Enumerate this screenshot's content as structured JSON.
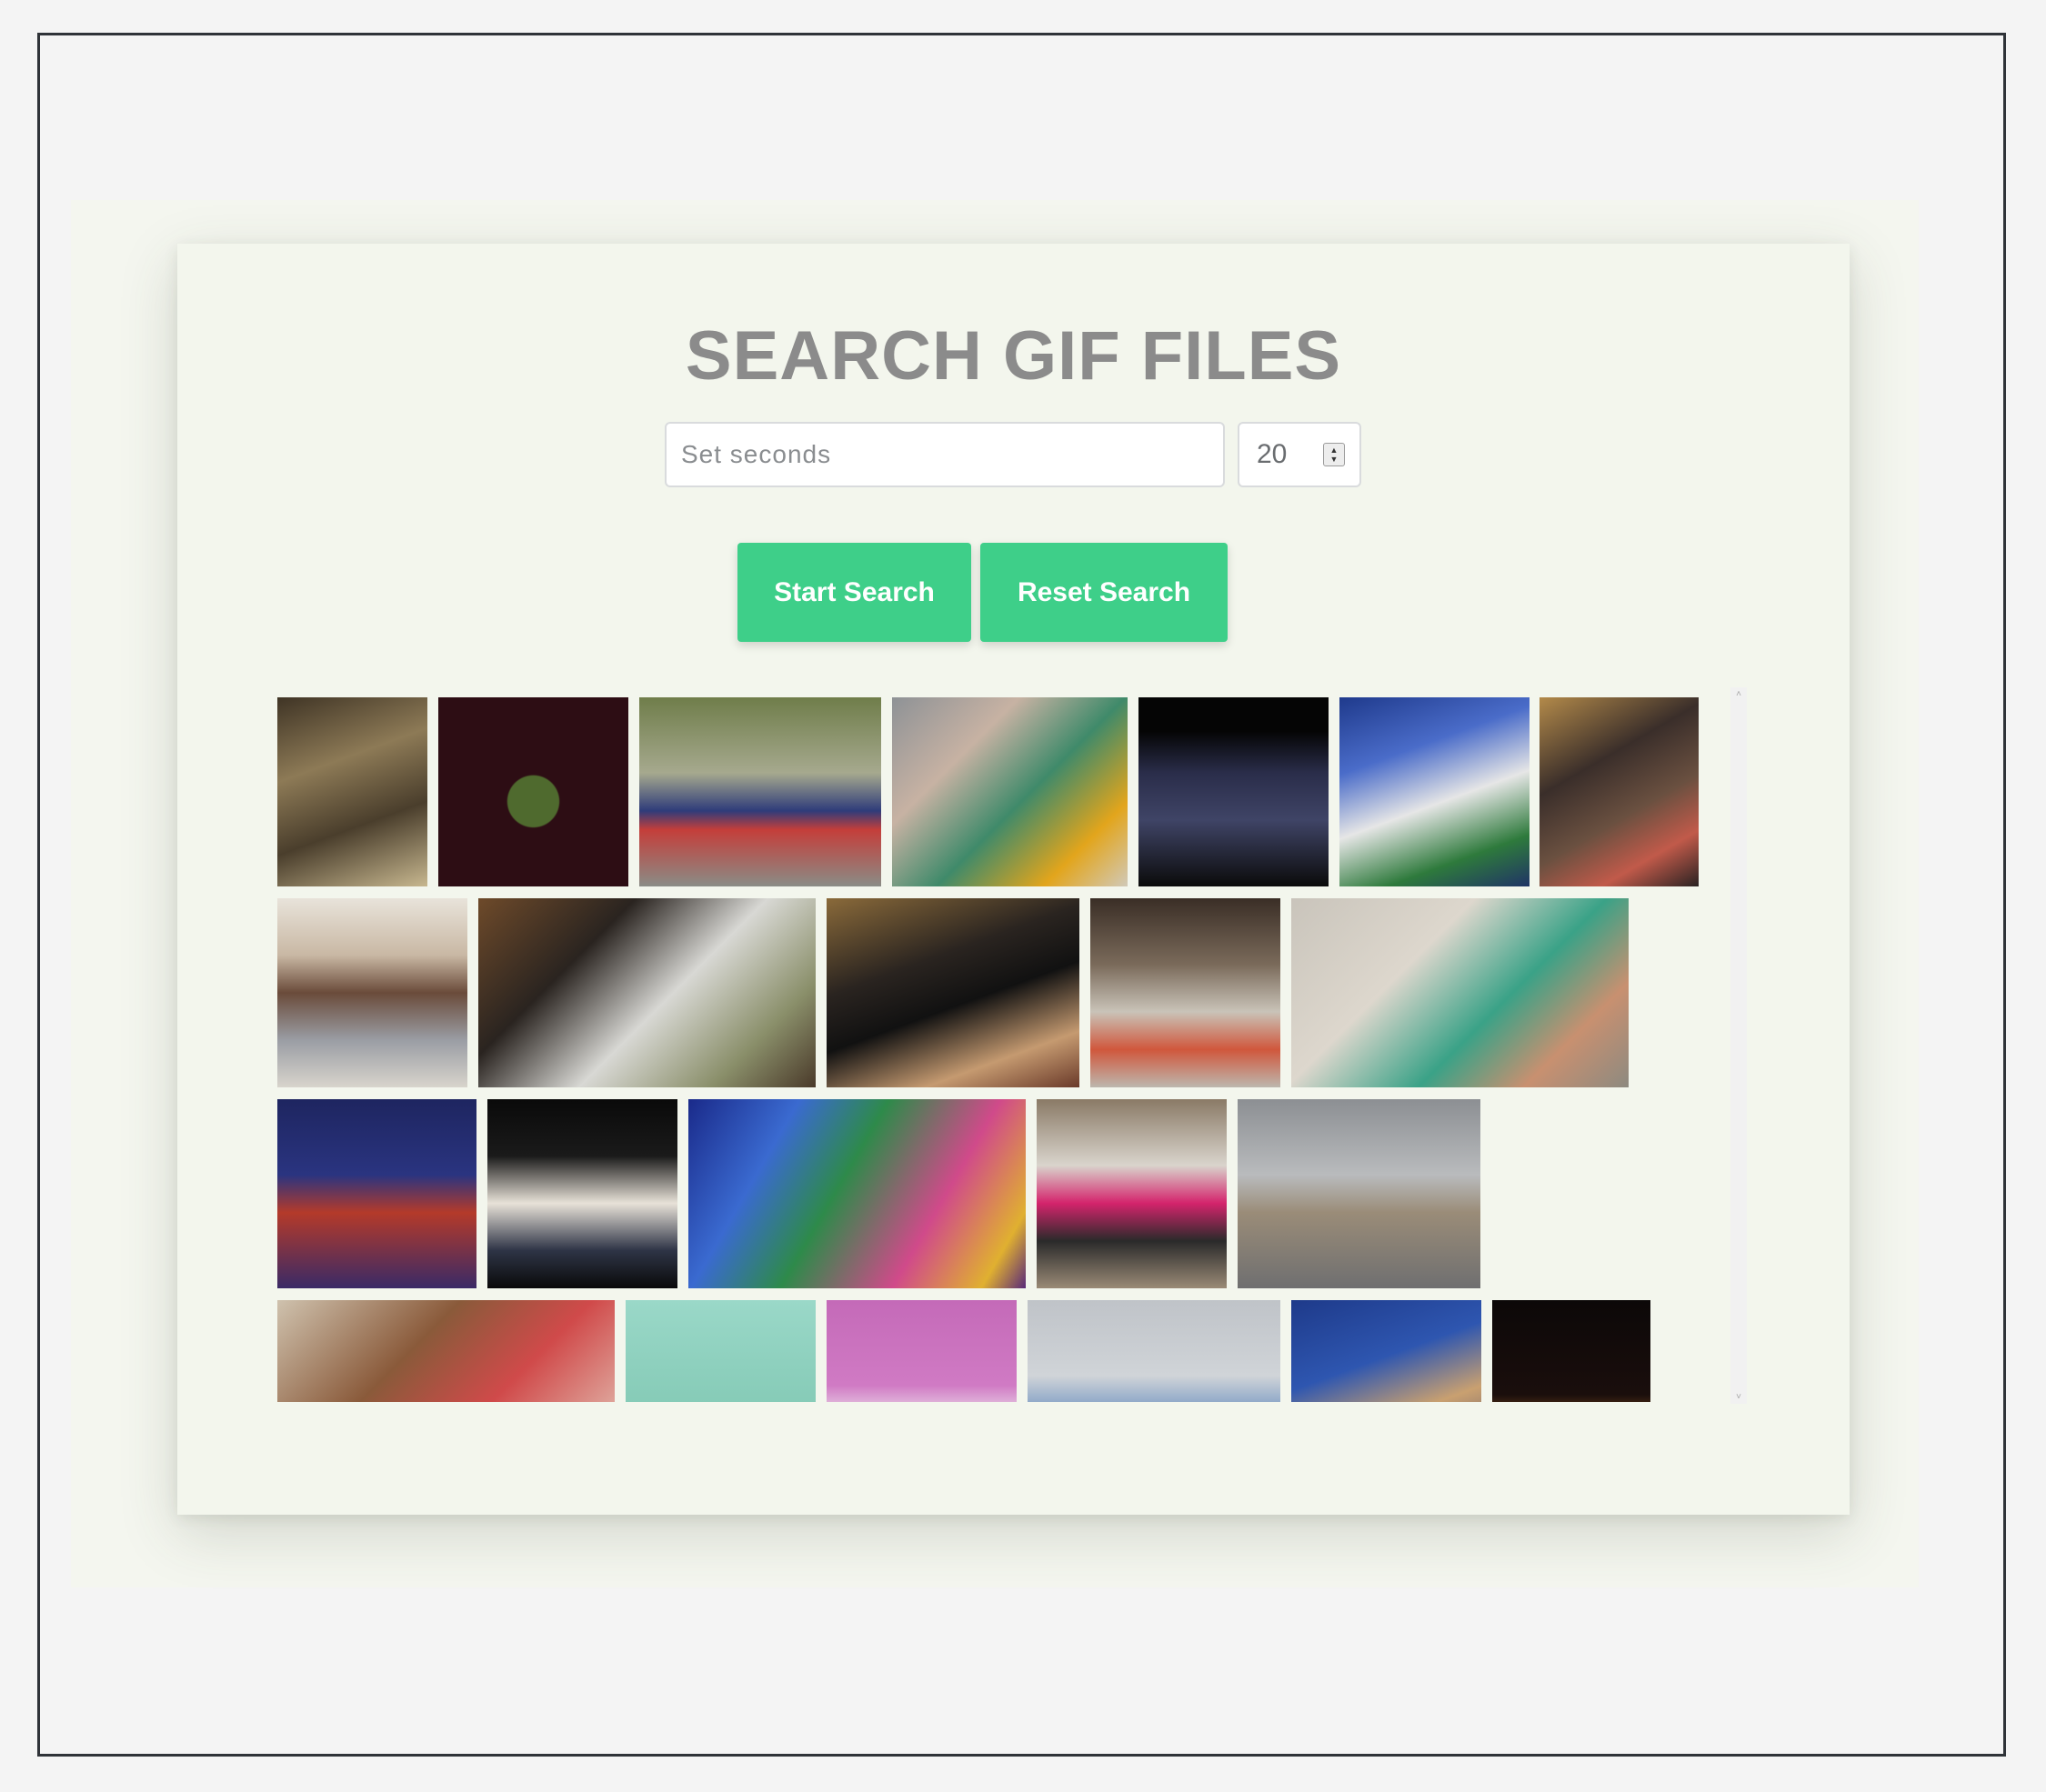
{
  "page": {
    "title": "SEARCH GIF FILES"
  },
  "controls": {
    "seconds_placeholder": "Set seconds",
    "seconds_value": "",
    "number_value": "20",
    "start_label": "Start Search",
    "reset_label": "Reset Search"
  },
  "colors": {
    "button": "#3ecf89",
    "title": "#8b8b8b",
    "card": "#f3f6ed"
  },
  "gallery": {
    "item_count": 25,
    "rows": 4,
    "icons": {
      "scroll_up": "scroll-up-icon",
      "scroll_down": "scroll-down-icon",
      "spinner": "spinner-icon"
    }
  }
}
